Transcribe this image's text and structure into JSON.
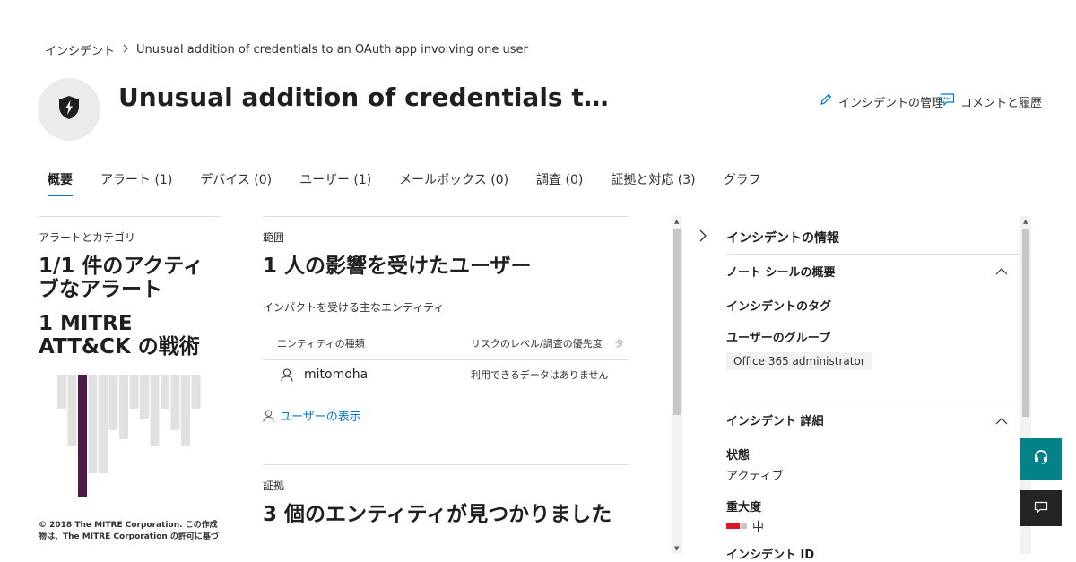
{
  "breadcrumb": {
    "root": "インシデント",
    "current": "Unusual addition of credentials to an OAuth app involving one user"
  },
  "header": {
    "title": "Unusual addition of credentials t…",
    "icon": "shield-bolt-icon",
    "actions": {
      "manage": "インシデントの管理",
      "comments": "コメントと履歴"
    }
  },
  "tabs": [
    {
      "label": "概要",
      "active": true
    },
    {
      "label": "アラート (1)"
    },
    {
      "label": "デバイス (0)"
    },
    {
      "label": "ユーザー (1)"
    },
    {
      "label": "メールボックス (0)"
    },
    {
      "label": "調査 (0)"
    },
    {
      "label": "証拠と対応 (3)"
    },
    {
      "label": "グラフ"
    }
  ],
  "alerts_card": {
    "label": "アラートとカテゴリ",
    "active_alerts_line1": "1/1 件のアクティ",
    "active_alerts_line2": "ブなアラート",
    "mitre_line1": "1 MITRE",
    "mitre_line2": "ATT&CK の戦術",
    "copyright_line1": "© 2018 The MITRE Corporation. この作成",
    "copyright_line2": "物は、The MITRE Corporation の許可に基づ",
    "bars": {
      "highlight_color": "#4b1c48",
      "base_color": "#e1e1e1",
      "highlighted_index": 2
    }
  },
  "scope_card": {
    "label": "範囲",
    "headline": "1 人の影響を受けたユーザー",
    "entities_label": "インパクトを受ける主なエンティティ",
    "columns": {
      "entity_type": "エンティティの種類",
      "risk_level": "リスクのレベル/調査の優先度",
      "extra": "タ"
    },
    "row": {
      "name": "mitomoha",
      "risk": "利用できるデータはありません"
    },
    "view_users": "ユーザーの表示"
  },
  "evidence_card": {
    "label": "証拠",
    "headline": "3 個のエンティティが見つかりました"
  },
  "right_pane": {
    "title": "インシデントの情報",
    "notebook_section": "ノート シールの概要",
    "tags_label": "インシデントのタグ",
    "user_group_label": "ユーザーのグループ",
    "user_group_value": "Office 365 administrator",
    "details_section": "インシデント 詳細",
    "status_label": "状態",
    "status_value": "アクティブ",
    "severity_label": "重大度",
    "severity_value": "中",
    "severity_color": "#e81123",
    "id_label": "インシデント ID"
  },
  "colors": {
    "accent": "#0078d4",
    "float_teal": "#038387",
    "float_dark": "#252423"
  }
}
